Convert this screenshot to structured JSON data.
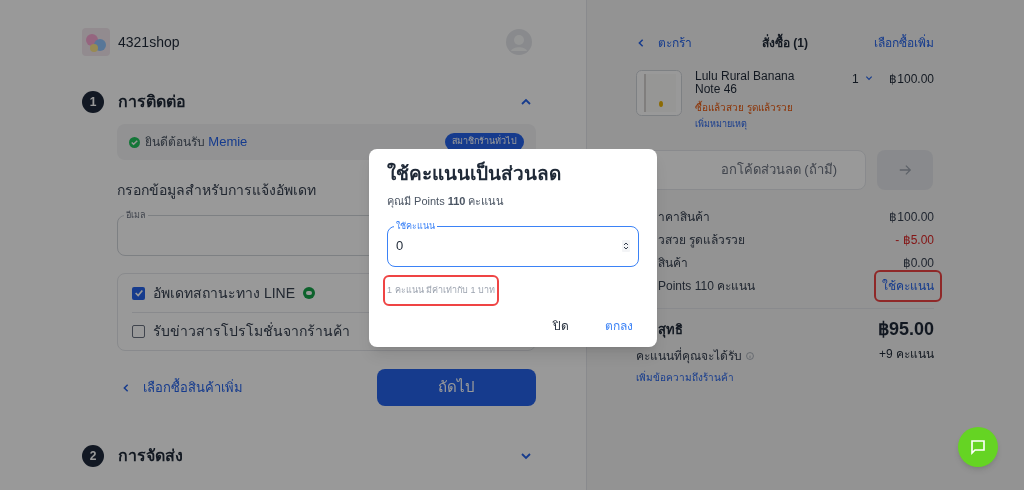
{
  "shop": {
    "name": "4321shop"
  },
  "sections": [
    {
      "number": "1",
      "title": "การติดต่อ",
      "expanded": true
    },
    {
      "number": "2",
      "title": "การจัดส่ง",
      "expanded": false
    }
  ],
  "contact": {
    "welcome": "ยินดีต้อนรับ",
    "member_name": "Memie",
    "badge": "สมาชิกร้านทั่วไป",
    "prompt": "กรอกข้อมูลสำหรับการแจ้งอัพเดท",
    "email_label": "อีเมล",
    "options": [
      {
        "label": "อัพเดทสถานะทาง LINE",
        "checked": true,
        "kind": "line"
      },
      {
        "label": "รับข่าวสารโปรโมชั่นจากร้านค้า",
        "checked": false,
        "kind": "plain"
      }
    ],
    "back_link": "เลือกซื้อสินค้าเพิ่ม",
    "next_button": "ถัดไป"
  },
  "order": {
    "back": "ตะกร้า",
    "title": "สั่งซื้อ (1)",
    "more": "เลือกซื้อเพิ่ม",
    "items": [
      {
        "name": "Lulu Rural Banana Note 46",
        "promo": "ซื้อแล้วสวย รูดแล้วรวย",
        "note_link": "เพิ่มหมายเหตุ",
        "qty": "1",
        "price": "฿100.00"
      }
    ],
    "coupon_placeholder": "อกโค้ดส่วนลด (ถ้ามี)",
    "summary": [
      {
        "label": "าคาสินค้า",
        "value": "฿100.00",
        "kind": "plain"
      },
      {
        "label": "วสวย รูดแล้วรวย",
        "value": "- ฿5.00",
        "kind": "discount"
      },
      {
        "label": "สินค้า",
        "value": "฿0.00",
        "kind": "plain"
      },
      {
        "label": "Points 110 คะแนน",
        "value": "ใช้คะแนน",
        "kind": "link",
        "highlighted": true
      }
    ],
    "total_label": "สุทธิ",
    "total": "฿95.00",
    "earn_label": "คะแนนที่คุณจะได้รับ",
    "earn_value": "+9 คะแนน",
    "message_link": "เพิ่มข้อความถึงร้านค้า"
  },
  "dialog": {
    "title": "ใช้คะแนนเป็นส่วนลด",
    "balance": "คุณมี Points **110** คะแนน",
    "field_label": "ใช้คะแนน",
    "value": "0",
    "hint": "1 คะแนน มีค่าเท่ากับ 1 บาท",
    "hint_highlighted": true,
    "buttons": [
      "ปิด",
      "ตกลง"
    ]
  }
}
